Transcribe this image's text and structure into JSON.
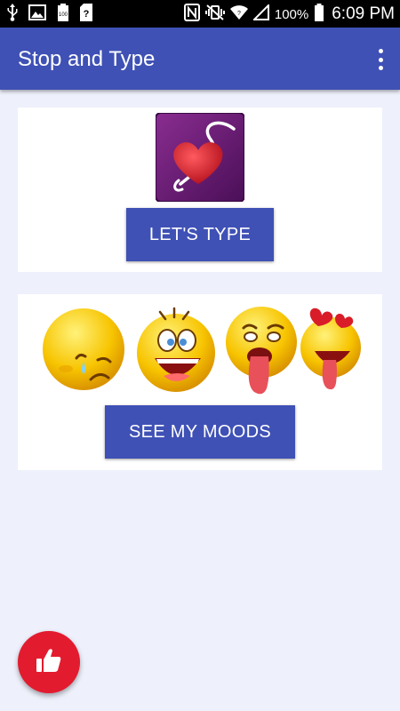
{
  "status_bar": {
    "battery_percent": "100%",
    "time": "6:09 PM",
    "left_icons": [
      "usb-icon",
      "image-icon",
      "battery-100-icon",
      "sim-unknown-icon"
    ],
    "right_icons": [
      "nfc-icon",
      "vibrate-mute-icon",
      "wifi-icon",
      "signal-icon",
      "battery-icon"
    ]
  },
  "app_bar": {
    "title": "Stop and Type",
    "menu_icon": "overflow-menu-icon"
  },
  "type_card": {
    "logo_icon": "heart-s-logo-icon",
    "button_label": "LET'S TYPE"
  },
  "moods_card": {
    "emojis": [
      "sad-teary-emoji",
      "laughing-emoji",
      "tongue-out-emoji",
      "crazy-heart-emoji"
    ],
    "button_label": "SEE MY MOODS"
  },
  "fab": {
    "icon": "thumbs-up-icon"
  },
  "colors": {
    "primary": "#3f51b5",
    "background": "#eef0fb",
    "fab": "#e31b2f",
    "logo_bg": "#6a1e78",
    "heart": "#d81d28",
    "emoji_yellow": "#f7c400"
  }
}
